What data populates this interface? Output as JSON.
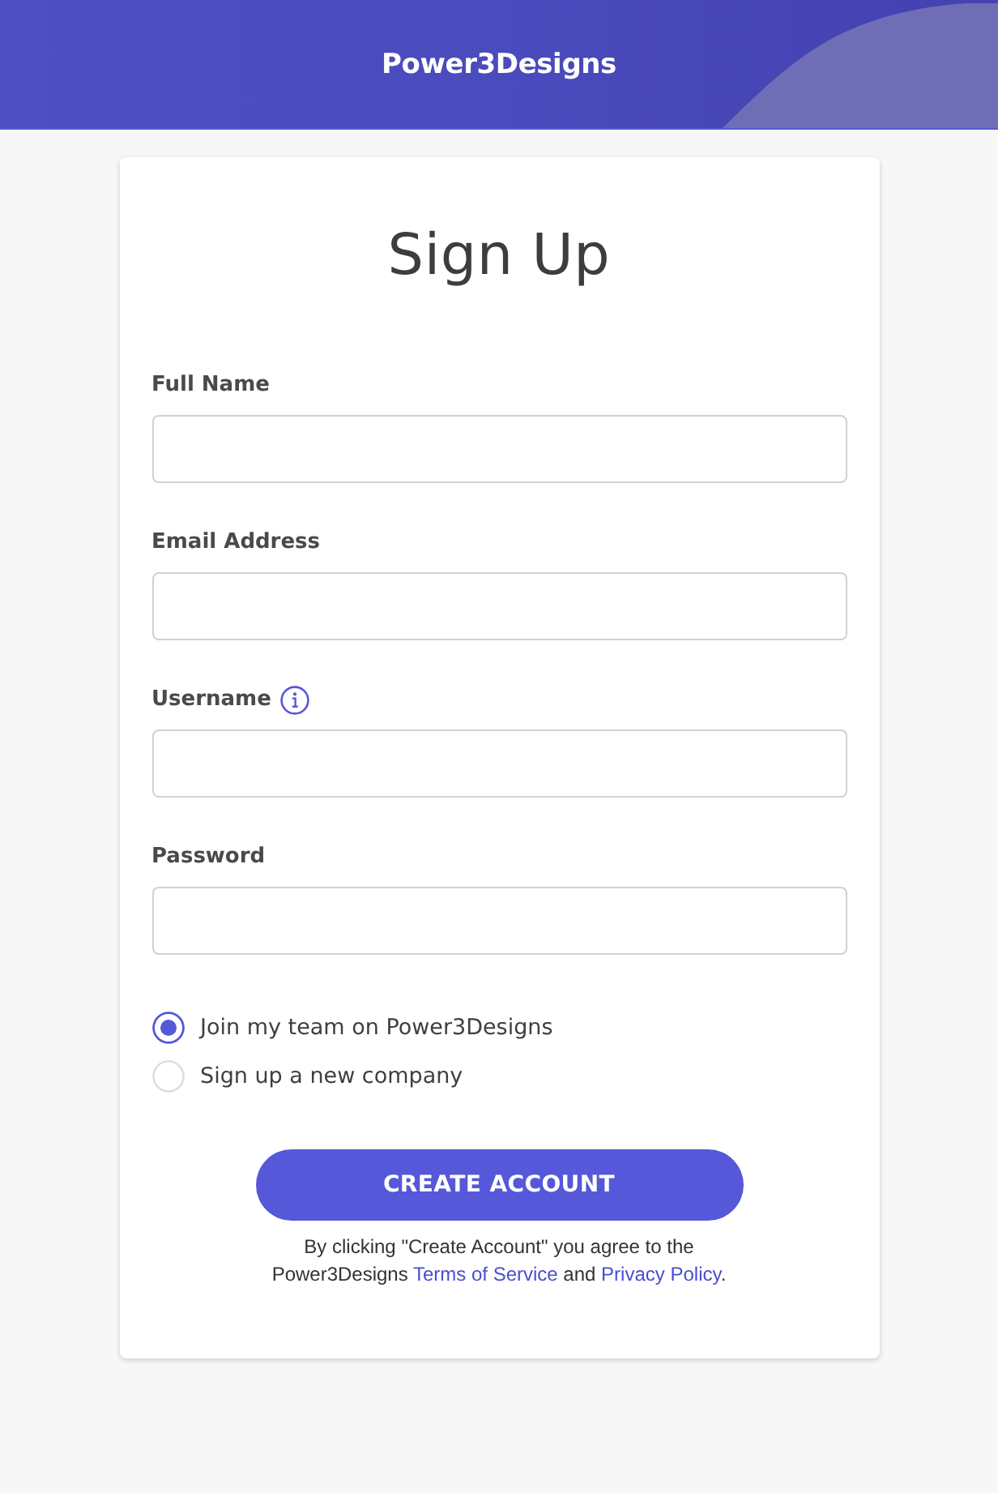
{
  "header": {
    "title": "Power3Designs"
  },
  "form": {
    "title": "Sign Up",
    "fields": [
      {
        "label": "Full Name",
        "info": false
      },
      {
        "label": "Email Address",
        "info": false
      },
      {
        "label": "Username",
        "info": true
      },
      {
        "label": "Password",
        "info": false
      }
    ],
    "options": [
      {
        "label": "Join my team on Power3Designs",
        "selected": true
      },
      {
        "label": "Sign up a new company",
        "selected": false
      }
    ],
    "submit": {
      "label": "CREATE ACCOUNT"
    },
    "terms": [
      {
        "kind": "text",
        "text": "By clicking \"Create Account\" you agree to the Power3Designs "
      },
      {
        "kind": "link",
        "text": "Terms of Service"
      },
      {
        "kind": "text",
        "text": " and "
      },
      {
        "kind": "link",
        "text": "Privacy Policy"
      },
      {
        "kind": "text",
        "text": "."
      }
    ]
  }
}
